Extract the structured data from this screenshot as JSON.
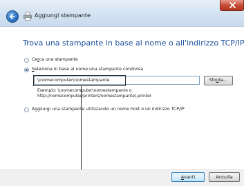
{
  "window": {
    "title": "Aggiungi stampante",
    "close_icon": "close-icon",
    "back_icon": "back-arrow-icon",
    "app_icon": "printer-icon"
  },
  "main": {
    "heading": "Trova una stampante in base al nome o all'indirizzo TCP/IP",
    "options": [
      {
        "prefix": "Ce",
        "accel": "r",
        "suffix": "ca una stampante",
        "checked": false
      },
      {
        "prefix": "",
        "accel": "S",
        "suffix": "eleziona in base al nome una stampante condivisa",
        "checked": true
      },
      {
        "prefix": "Aggiungi una stampante utilizzando un nome host o un indirizzo TCP/IP",
        "accel": "",
        "suffix": "",
        "checked": false
      }
    ],
    "share_input_value": "\\\\nomecomputer\\nomestampante",
    "browse": {
      "prefix": "Sfo",
      "accel": "g",
      "suffix": "lia..."
    },
    "example_text": "Esempio: \\\\nomecomputer\\nomestampante o\nhttp://nomecomputer/printers/nomestampante/.printer"
  },
  "footer": {
    "next": {
      "prefix": "",
      "accel": "A",
      "suffix": "vanti"
    },
    "cancel_label": "Annulla"
  },
  "colors": {
    "heading": "#1b4f9a",
    "titlebar": "#d3e2f1",
    "close": "#c64a34"
  }
}
